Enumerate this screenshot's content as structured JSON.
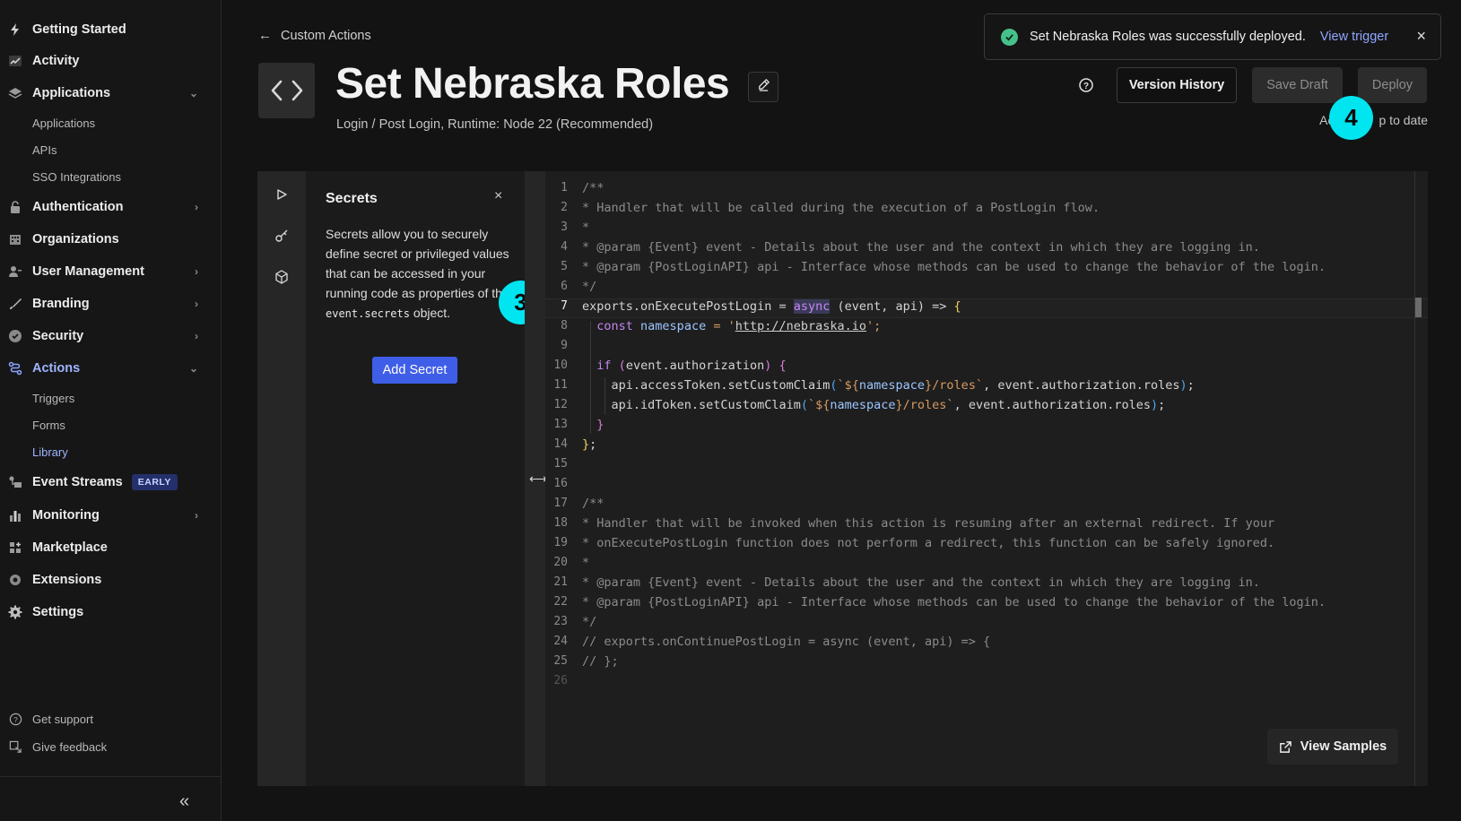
{
  "sidebar": {
    "items": [
      {
        "label": "Getting Started",
        "icon": "bolt-icon"
      },
      {
        "label": "Activity",
        "icon": "activity-chart-icon"
      },
      {
        "label": "Applications",
        "icon": "layers-icon"
      },
      {
        "label": "Authentication",
        "icon": "lock-icon"
      },
      {
        "label": "Organizations",
        "icon": "building-icon"
      },
      {
        "label": "User Management",
        "icon": "users-icon"
      },
      {
        "label": "Branding",
        "icon": "brush-icon"
      },
      {
        "label": "Security",
        "icon": "shield-check-icon"
      },
      {
        "label": "Actions",
        "icon": "flow-icon"
      },
      {
        "label": "Event Streams",
        "icon": "stream-icon",
        "badge": "EARLY"
      },
      {
        "label": "Monitoring",
        "icon": "bar-chart-icon"
      },
      {
        "label": "Marketplace",
        "icon": "grid-plus-icon"
      },
      {
        "label": "Extensions",
        "icon": "puzzle-icon"
      },
      {
        "label": "Settings",
        "icon": "gear-icon"
      }
    ],
    "applications_sub": [
      "Applications",
      "APIs",
      "SSO Integrations"
    ],
    "actions_sub": [
      "Triggers",
      "Forms",
      "Library"
    ],
    "footer": [
      {
        "label": "Get support",
        "icon": "help-circle-icon"
      },
      {
        "label": "Give feedback",
        "icon": "feedback-icon"
      }
    ],
    "collapse_label": "«"
  },
  "header": {
    "breadcrumb": "Custom Actions",
    "title": "Set Nebraska Roles",
    "subtitle": "Login / Post Login, Runtime: Node 22 (Recommended)",
    "buttons": {
      "version_history": "Version History",
      "save_draft": "Save Draft",
      "deploy": "Deploy"
    },
    "status_text": "Action up to date",
    "status_visible_prefix": "Ac",
    "status_visible_suffix": "p to date"
  },
  "toast": {
    "message": "Set Nebraska Roles was successfully deployed.",
    "link": "View trigger",
    "close": "×"
  },
  "steps": {
    "left": "3",
    "right": "4"
  },
  "secrets": {
    "title": "Secrets",
    "close": "×",
    "description_text": "Secrets allow you to securely define secret or privileged values that can be accessed in your running code as properties of the",
    "description_code": "event.secrets",
    "description_tail": "object.",
    "add_button": "Add Secret"
  },
  "editor": {
    "line_numbers": [
      "1",
      "2",
      "3",
      "4",
      "5",
      "6",
      "7",
      "8",
      "9",
      "10",
      "11",
      "12",
      "13",
      "14",
      "15",
      "16",
      "17",
      "18",
      "19",
      "20",
      "21",
      "22",
      "23",
      "24",
      "25",
      "26"
    ],
    "current_line": "7",
    "lines": {
      "l1": "/**",
      "l2": "* Handler that will be called during the execution of a PostLogin flow.",
      "l3": "*",
      "l4": "* @param {Event} event - Details about the user and the context in which they are logging in.",
      "l5": "* @param {PostLoginAPI} api - Interface whose methods can be used to change the behavior of the login.",
      "l6": "*/",
      "l7a": "exports.onExecutePostLogin = ",
      "l7b": "async",
      "l7c": " (event, api) => ",
      "l8a": "const",
      "l8b": "namespace",
      "l8c": " = '",
      "l8d": "http://nebraska.io",
      "l8e": "';",
      "l10a": "if",
      "l10b": "event.authorization",
      "l11a": "api.accessToken.setCustomClaim",
      "l11b": "`${",
      "l11c": "namespace",
      "l11d": "}/roles`",
      "l11e": ", event.authorization.roles",
      "l12a": "api.idToken.setCustomClaim",
      "l12e": ", event.authorization.roles",
      "l17": "/**",
      "l18": "* Handler that will be invoked when this action is resuming after an external redirect. If your",
      "l19": "* onExecutePostLogin function does not perform a redirect, this function can be safely ignored.",
      "l20": "*",
      "l21": "* @param {Event} event - Details about the user and the context in which they are logging in.",
      "l22": "* @param {PostLoginAPI} api - Interface whose methods can be used to change the behavior of the login.",
      "l23": "*/",
      "l24": "// exports.onContinuePostLogin = async (event, api) => {",
      "l25": "// };"
    },
    "view_samples": "View Samples"
  },
  "colors": {
    "accent": "#3f5ee8",
    "active_nav": "#9fb4ff",
    "step_badge": "#00e5f0",
    "success": "#45c28a"
  }
}
